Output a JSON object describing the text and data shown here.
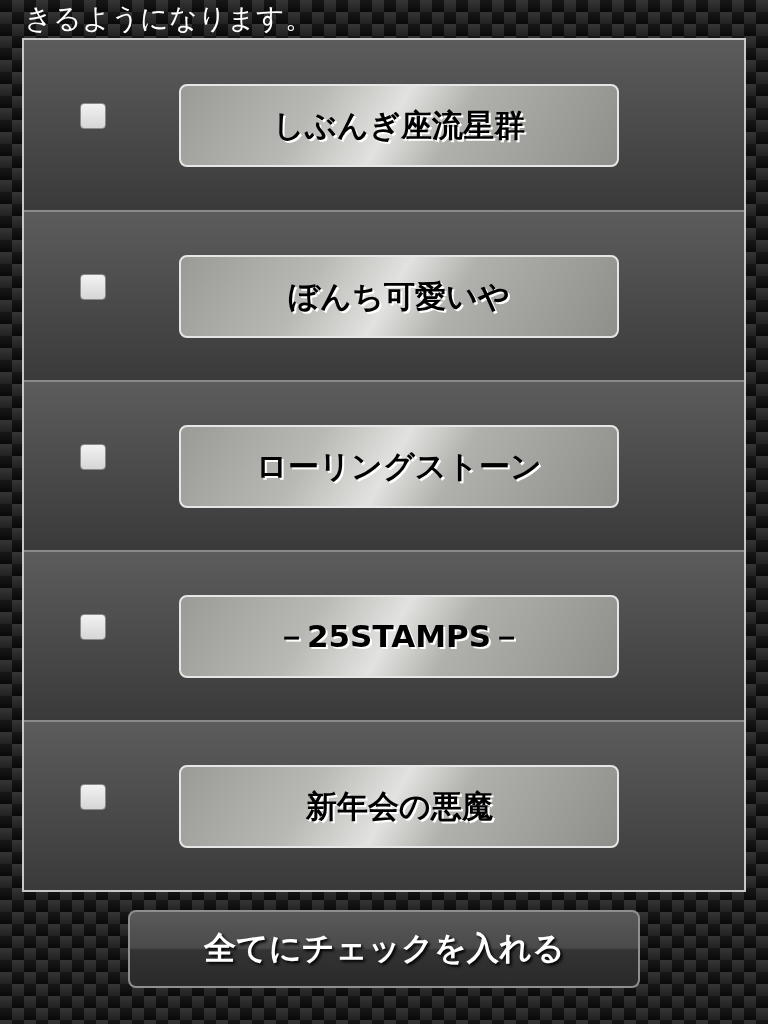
{
  "intro_text": "きるようになります。",
  "items": [
    {
      "label": "しぶんぎ座流星群",
      "checked": false
    },
    {
      "label": "ぼんち可愛いや",
      "checked": false
    },
    {
      "label": "ローリングストーン",
      "checked": false
    },
    {
      "label": "－25STAMPS－",
      "checked": false
    },
    {
      "label": "新年会の悪魔",
      "checked": false
    }
  ],
  "check_all_button": "全てにチェックを入れる"
}
